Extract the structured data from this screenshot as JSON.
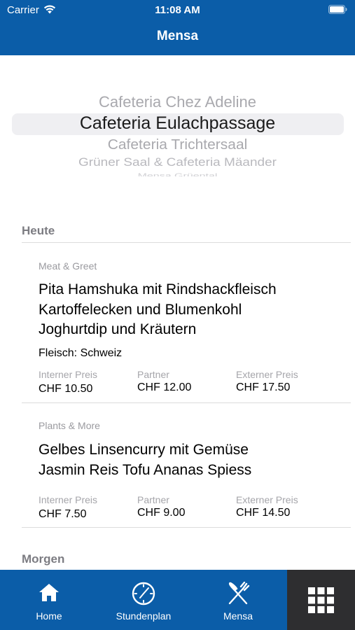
{
  "status_bar": {
    "carrier": "Carrier",
    "time": "11:08 AM"
  },
  "nav": {
    "title": "Mensa"
  },
  "picker": {
    "items": [
      "Cafeteria Chez Adeline",
      "Cafeteria Eulachpassage",
      "Cafeteria Trichtersaal",
      "Grüner Saal & Cafeteria Mäander",
      "Mensa Grüental"
    ],
    "selected": "Cafeteria Eulachpassage"
  },
  "sections": [
    {
      "title": "Heute",
      "meals": [
        {
          "category": "Meat & Greet",
          "lines": [
            "Pita Hamshuka mit Rindshackfleisch",
            "Kartoffelecken und Blumenkohl",
            "Joghurtdip und Kräutern"
          ],
          "origin": "Fleisch: Schweiz",
          "prices": [
            {
              "label": "Interner Preis",
              "value": "CHF 10.50"
            },
            {
              "label": "Partner",
              "value": "CHF 12.00"
            },
            {
              "label": "Externer Preis",
              "value": "CHF 17.50"
            }
          ]
        },
        {
          "category": "Plants & More",
          "lines": [
            "Gelbes Linsencurry mit Gemüse",
            "Jasmin Reis Tofu Ananas Spiess"
          ],
          "prices": [
            {
              "label": "Interner Preis",
              "value": "CHF 7.50"
            },
            {
              "label": "Partner",
              "value": "CHF 9.00"
            },
            {
              "label": "Externer Preis",
              "value": "CHF 14.50"
            }
          ]
        }
      ]
    },
    {
      "title": "Morgen"
    }
  ],
  "tabbar": {
    "tabs": [
      {
        "label": "Home",
        "icon": "home-icon"
      },
      {
        "label": "Stundenplan",
        "icon": "clock-icon"
      },
      {
        "label": "Mensa",
        "icon": "fork-knife-icon"
      }
    ],
    "more_icon": "grid-icon",
    "colors": {
      "bar": "#0b5da8",
      "more": "#2e2e30"
    }
  }
}
